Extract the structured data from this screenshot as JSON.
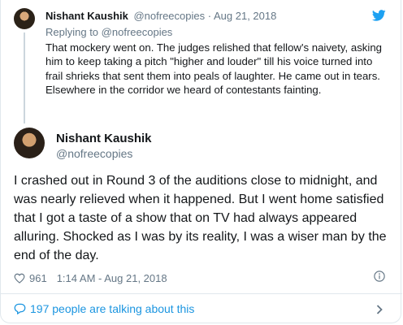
{
  "parent_tweet": {
    "name": "Nishant Kaushik",
    "handle": "@nofreecopies",
    "separator": "·",
    "date": "Aug 21, 2018",
    "replying_prefix": "Replying to",
    "replying_to": "@nofreecopies",
    "text": "That mockery went on. The judges relished that fellow's naivety, asking him to keep taking a pitch \"higher and louder\" till his voice turned into frail shrieks that sent them into peals of laughter. He came out in tears. Elsewhere in the corridor we heard of contestants fainting."
  },
  "main_tweet": {
    "name": "Nishant Kaushik",
    "handle": "@nofreecopies",
    "text": "I crashed out in Round 3 of the auditions close to midnight, and was nearly relieved when it happened. But I went home satisfied that I got a taste of a show that on TV had always appeared alluring. Shocked as I was by its reality, I was a wiser man by the end of the day.",
    "likes": "961",
    "timestamp": "1:14 AM - Aug 21, 2018"
  },
  "footer": {
    "conversation": "197 people are talking about this"
  },
  "icons": {
    "brand": "twitter-bird-icon",
    "like": "heart-icon",
    "info": "info-icon",
    "conversation": "speech-bubble-icon",
    "open": "chevron-right-icon"
  },
  "colors": {
    "accent": "#1da1f2",
    "link": "#1b95e0",
    "muted": "#657786",
    "border": "#e1e8ed"
  }
}
